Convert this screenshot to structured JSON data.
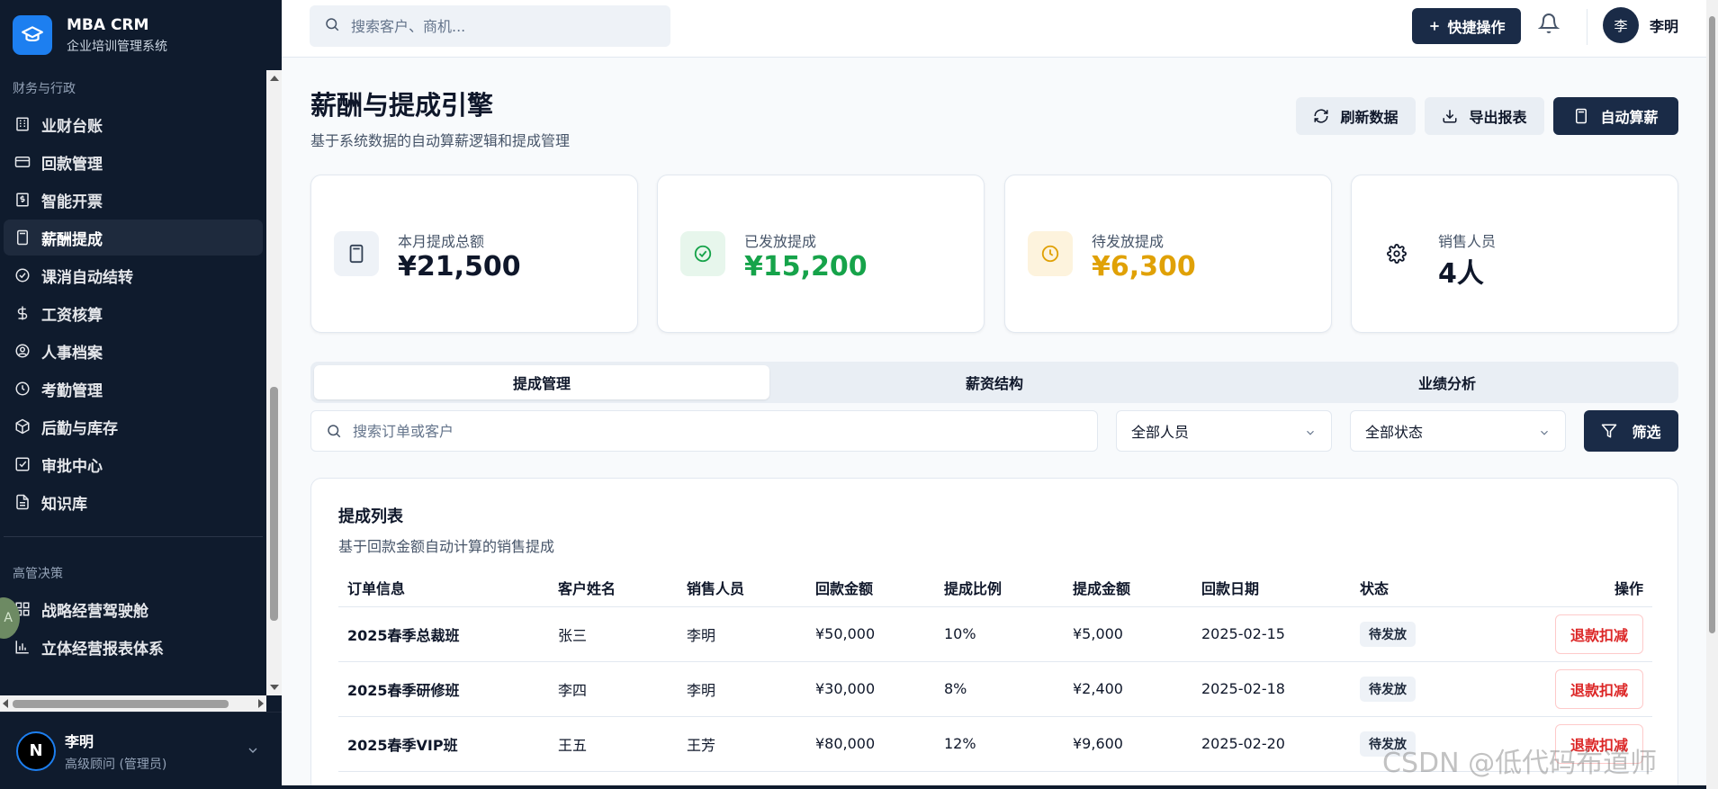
{
  "brand": {
    "title": "MBA CRM",
    "subtitle": "企业培训管理系统"
  },
  "sidebar": {
    "section_finance": "财务与行政",
    "items": [
      {
        "label": "业财台账",
        "icon": "building-icon"
      },
      {
        "label": "回款管理",
        "icon": "credit-card-icon"
      },
      {
        "label": "智能开票",
        "icon": "invoice-dollar-icon"
      },
      {
        "label": "薪酬提成",
        "icon": "calculator-icon",
        "active": true
      },
      {
        "label": "课消自动结转",
        "icon": "check-circle-icon"
      },
      {
        "label": "工资核算",
        "icon": "dollar-icon"
      },
      {
        "label": "人事档案",
        "icon": "user-circle-icon"
      },
      {
        "label": "考勤管理",
        "icon": "clock-icon"
      },
      {
        "label": "后勤与库存",
        "icon": "package-icon"
      },
      {
        "label": "审批中心",
        "icon": "check-square-icon"
      },
      {
        "label": "知识库",
        "icon": "file-text-icon"
      }
    ],
    "section_exec": "高管决策",
    "exec_items": [
      {
        "label": "战略经营驾驶舱",
        "icon": "grid-icon"
      },
      {
        "label": "立体经营报表体系",
        "icon": "bar-chart-icon"
      }
    ],
    "float_letter": "A"
  },
  "user_footer": {
    "avatar": "N",
    "name": "李明",
    "role": "高级顾问 (管理员)"
  },
  "topbar": {
    "search_placeholder": "搜索客户、商机...",
    "quick_action": "快捷操作",
    "user_avatar": "李",
    "user_name": "李明"
  },
  "page": {
    "title": "薪酬与提成引擎",
    "subtitle": "基于系统数据的自动算薪逻辑和提成管理",
    "refresh": "刷新数据",
    "export": "导出报表",
    "auto_calc": "自动算薪"
  },
  "stats": [
    {
      "label": "本月提成总额",
      "value": "¥21,500",
      "color": "#0f172a",
      "icon": "calculator-icon",
      "bg": "#eef2f7",
      "fg": "#334155"
    },
    {
      "label": "已发放提成",
      "value": "¥15,200",
      "color": "#16a34a",
      "icon": "check-circle-icon",
      "bg": "#e7f6ec",
      "fg": "#16a34a"
    },
    {
      "label": "待发放提成",
      "value": "¥6,300",
      "color": "#e0a106",
      "icon": "clock-icon",
      "bg": "#fdf3dd",
      "fg": "#e0a106"
    },
    {
      "label": "销售人员",
      "value": "4人",
      "color": "#0f172a",
      "icon": "gear-icon",
      "bg": "#ffffff",
      "fg": "#0f172a"
    }
  ],
  "tabs": [
    "提成管理",
    "薪资结构",
    "业绩分析"
  ],
  "filters": {
    "search_placeholder": "搜索订单或客户",
    "person": "全部人员",
    "status": "全部状态",
    "filter_btn": "筛选"
  },
  "table": {
    "title": "提成列表",
    "subtitle": "基于回款金额自动计算的销售提成",
    "headers": [
      "订单信息",
      "客户姓名",
      "销售人员",
      "回款金额",
      "提成比例",
      "提成金额",
      "回款日期",
      "状态",
      "操作"
    ],
    "rows": [
      {
        "order": "2025春季总裁班",
        "customer": "张三",
        "sales": "李明",
        "amount": "¥50,000",
        "rate": "10%",
        "commission": "¥5,000",
        "date": "2025-02-15",
        "status": "待发放",
        "action": "退款扣减"
      },
      {
        "order": "2025春季研修班",
        "customer": "李四",
        "sales": "李明",
        "amount": "¥30,000",
        "rate": "8%",
        "commission": "¥2,400",
        "date": "2025-02-18",
        "status": "待发放",
        "action": "退款扣减"
      },
      {
        "order": "2025春季VIP班",
        "customer": "王五",
        "sales": "王芳",
        "amount": "¥80,000",
        "rate": "12%",
        "commission": "¥9,600",
        "date": "2025-02-20",
        "status": "待发放",
        "action": "退款扣减"
      }
    ]
  },
  "watermark": "CSDN @低代码布道师"
}
